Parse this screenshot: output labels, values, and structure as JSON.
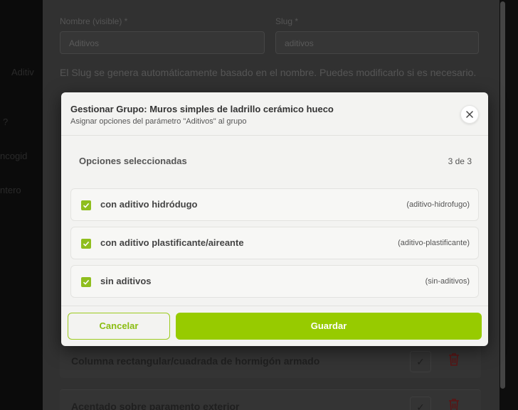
{
  "background": {
    "fields": {
      "name_label": "Nombre (visible) *",
      "name_value": "Aditivos",
      "slug_label": "Slug *",
      "slug_value": "aditivos",
      "hint": "El Slug se genera automáticamente basado en el nombre. Puedes modificarlo si es necesario."
    },
    "left_fragments": [
      "Aditiv",
      "?",
      "ncogid",
      "ntero"
    ],
    "rows": [
      {
        "label": "Columna rectangular/cuadrada de hormigón armado"
      },
      {
        "label": "Acentado sobre paramento exterior"
      }
    ]
  },
  "modal": {
    "title": "Gestionar Grupo: Muros simples de ladrillo cerámico hueco",
    "subtitle": "Asignar opciones del parámetro \"Aditivos\" al grupo",
    "close_icon": "close-icon",
    "selected_header": "Opciones seleccionadas",
    "count": "3 de 3",
    "options": [
      {
        "name": "con aditivo hidródugo",
        "slug": "(aditivo-hidrofugo)",
        "checked": true
      },
      {
        "name": "con aditivo plastificante/aireante",
        "slug": "(aditivo-plastificante)",
        "checked": true
      },
      {
        "name": "sin aditivos",
        "slug": "(sin-aditivos)",
        "checked": true
      }
    ],
    "cancel_label": "Cancelar",
    "save_label": "Guardar"
  },
  "colors": {
    "accent": "#97cb00",
    "checkbox": "#8fbe1e",
    "overlay": "#313131"
  }
}
